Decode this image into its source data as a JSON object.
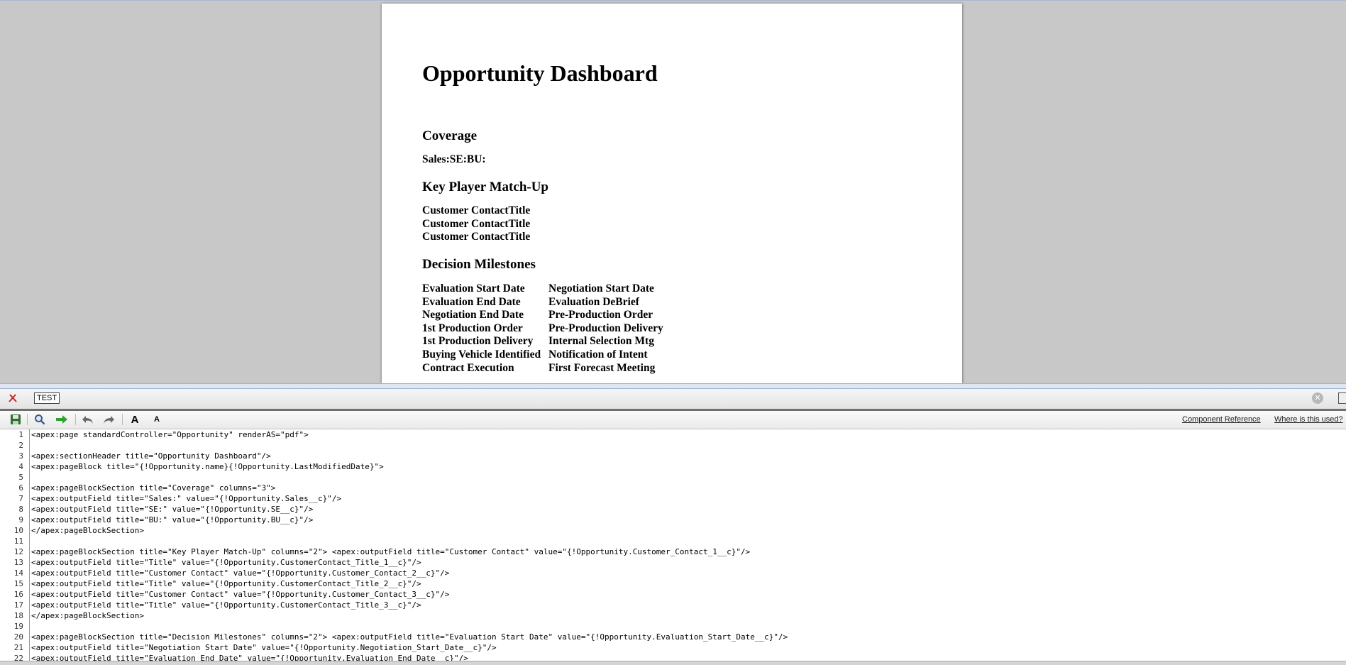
{
  "preview": {
    "title": "Opportunity Dashboard",
    "coverage_heading": "Coverage",
    "coverage_line": "Sales:SE:BU:",
    "key_player_heading": "Key Player Match-Up",
    "key_player_lines": [
      "Customer ContactTitle",
      "Customer ContactTitle",
      "Customer ContactTitle"
    ],
    "milestones_heading": "Decision Milestones",
    "milestones": [
      [
        "Evaluation Start Date",
        "Negotiation Start Date"
      ],
      [
        "Evaluation End Date",
        "Evaluation DeBrief"
      ],
      [
        "Negotiation End Date",
        "Pre-Production Order"
      ],
      [
        "1st Production Order",
        "Pre-Production Delivery"
      ],
      [
        "1st Production Delivery",
        "Internal Selection Mtg"
      ],
      [
        "Buying Vehicle Identified",
        "Notification of Intent"
      ],
      [
        "Contract Execution",
        "First Forecast Meeting"
      ]
    ]
  },
  "editor": {
    "page_name": "TEST",
    "close_icon": "x-icon",
    "toolbar": {
      "component_reference": "Component Reference",
      "where_used": "Where is this used?"
    },
    "lines": [
      "<apex:page standardController=\"Opportunity\" renderAS=\"pdf\">",
      "",
      "<apex:sectionHeader title=\"Opportunity Dashboard\"/>",
      "<apex:pageBlock title=\"{!Opportunity.name}{!Opportunity.LastModifiedDate}\">",
      "",
      "<apex:pageBlockSection title=\"Coverage\" columns=\"3\">",
      "<apex:outputField title=\"Sales:\" value=\"{!Opportunity.Sales__c}\"/>",
      "<apex:outputField title=\"SE:\" value=\"{!Opportunity.SE__c}\"/>",
      "<apex:outputField title=\"BU:\" value=\"{!Opportunity.BU__c}\"/>",
      "</apex:pageBlockSection>",
      "",
      "<apex:pageBlockSection title=\"Key Player Match-Up\" columns=\"2\"> <apex:outputField title=\"Customer Contact\" value=\"{!Opportunity.Customer_Contact_1__c}\"/>",
      "<apex:outputField title=\"Title\" value=\"{!Opportunity.CustomerContact_Title_1__c}\"/>",
      "<apex:outputField title=\"Customer Contact\" value=\"{!Opportunity.Customer_Contact_2__c}\"/>",
      "<apex:outputField title=\"Title\" value=\"{!Opportunity.CustomerContact_Title_2__c}\"/>",
      "<apex:outputField title=\"Customer Contact\" value=\"{!Opportunity.Customer_Contact_3__c}\"/>",
      "<apex:outputField title=\"Title\" value=\"{!Opportunity.CustomerContact_Title_3__c}\"/>",
      "</apex:pageBlockSection>",
      "",
      "<apex:pageBlockSection title=\"Decision Milestones\" columns=\"2\"> <apex:outputField title=\"Evaluation Start Date\" value=\"{!Opportunity.Evaluation_Start_Date__c}\"/>",
      "<apex:outputField title=\"Negotiation Start Date\" value=\"{!Opportunity.Negotiation_Start_Date__c}\"/>",
      "<apex:outputField title=\"Evaluation End Date\" value=\"{!Opportunity.Evaluation_End_Date__c}\"/>"
    ]
  }
}
